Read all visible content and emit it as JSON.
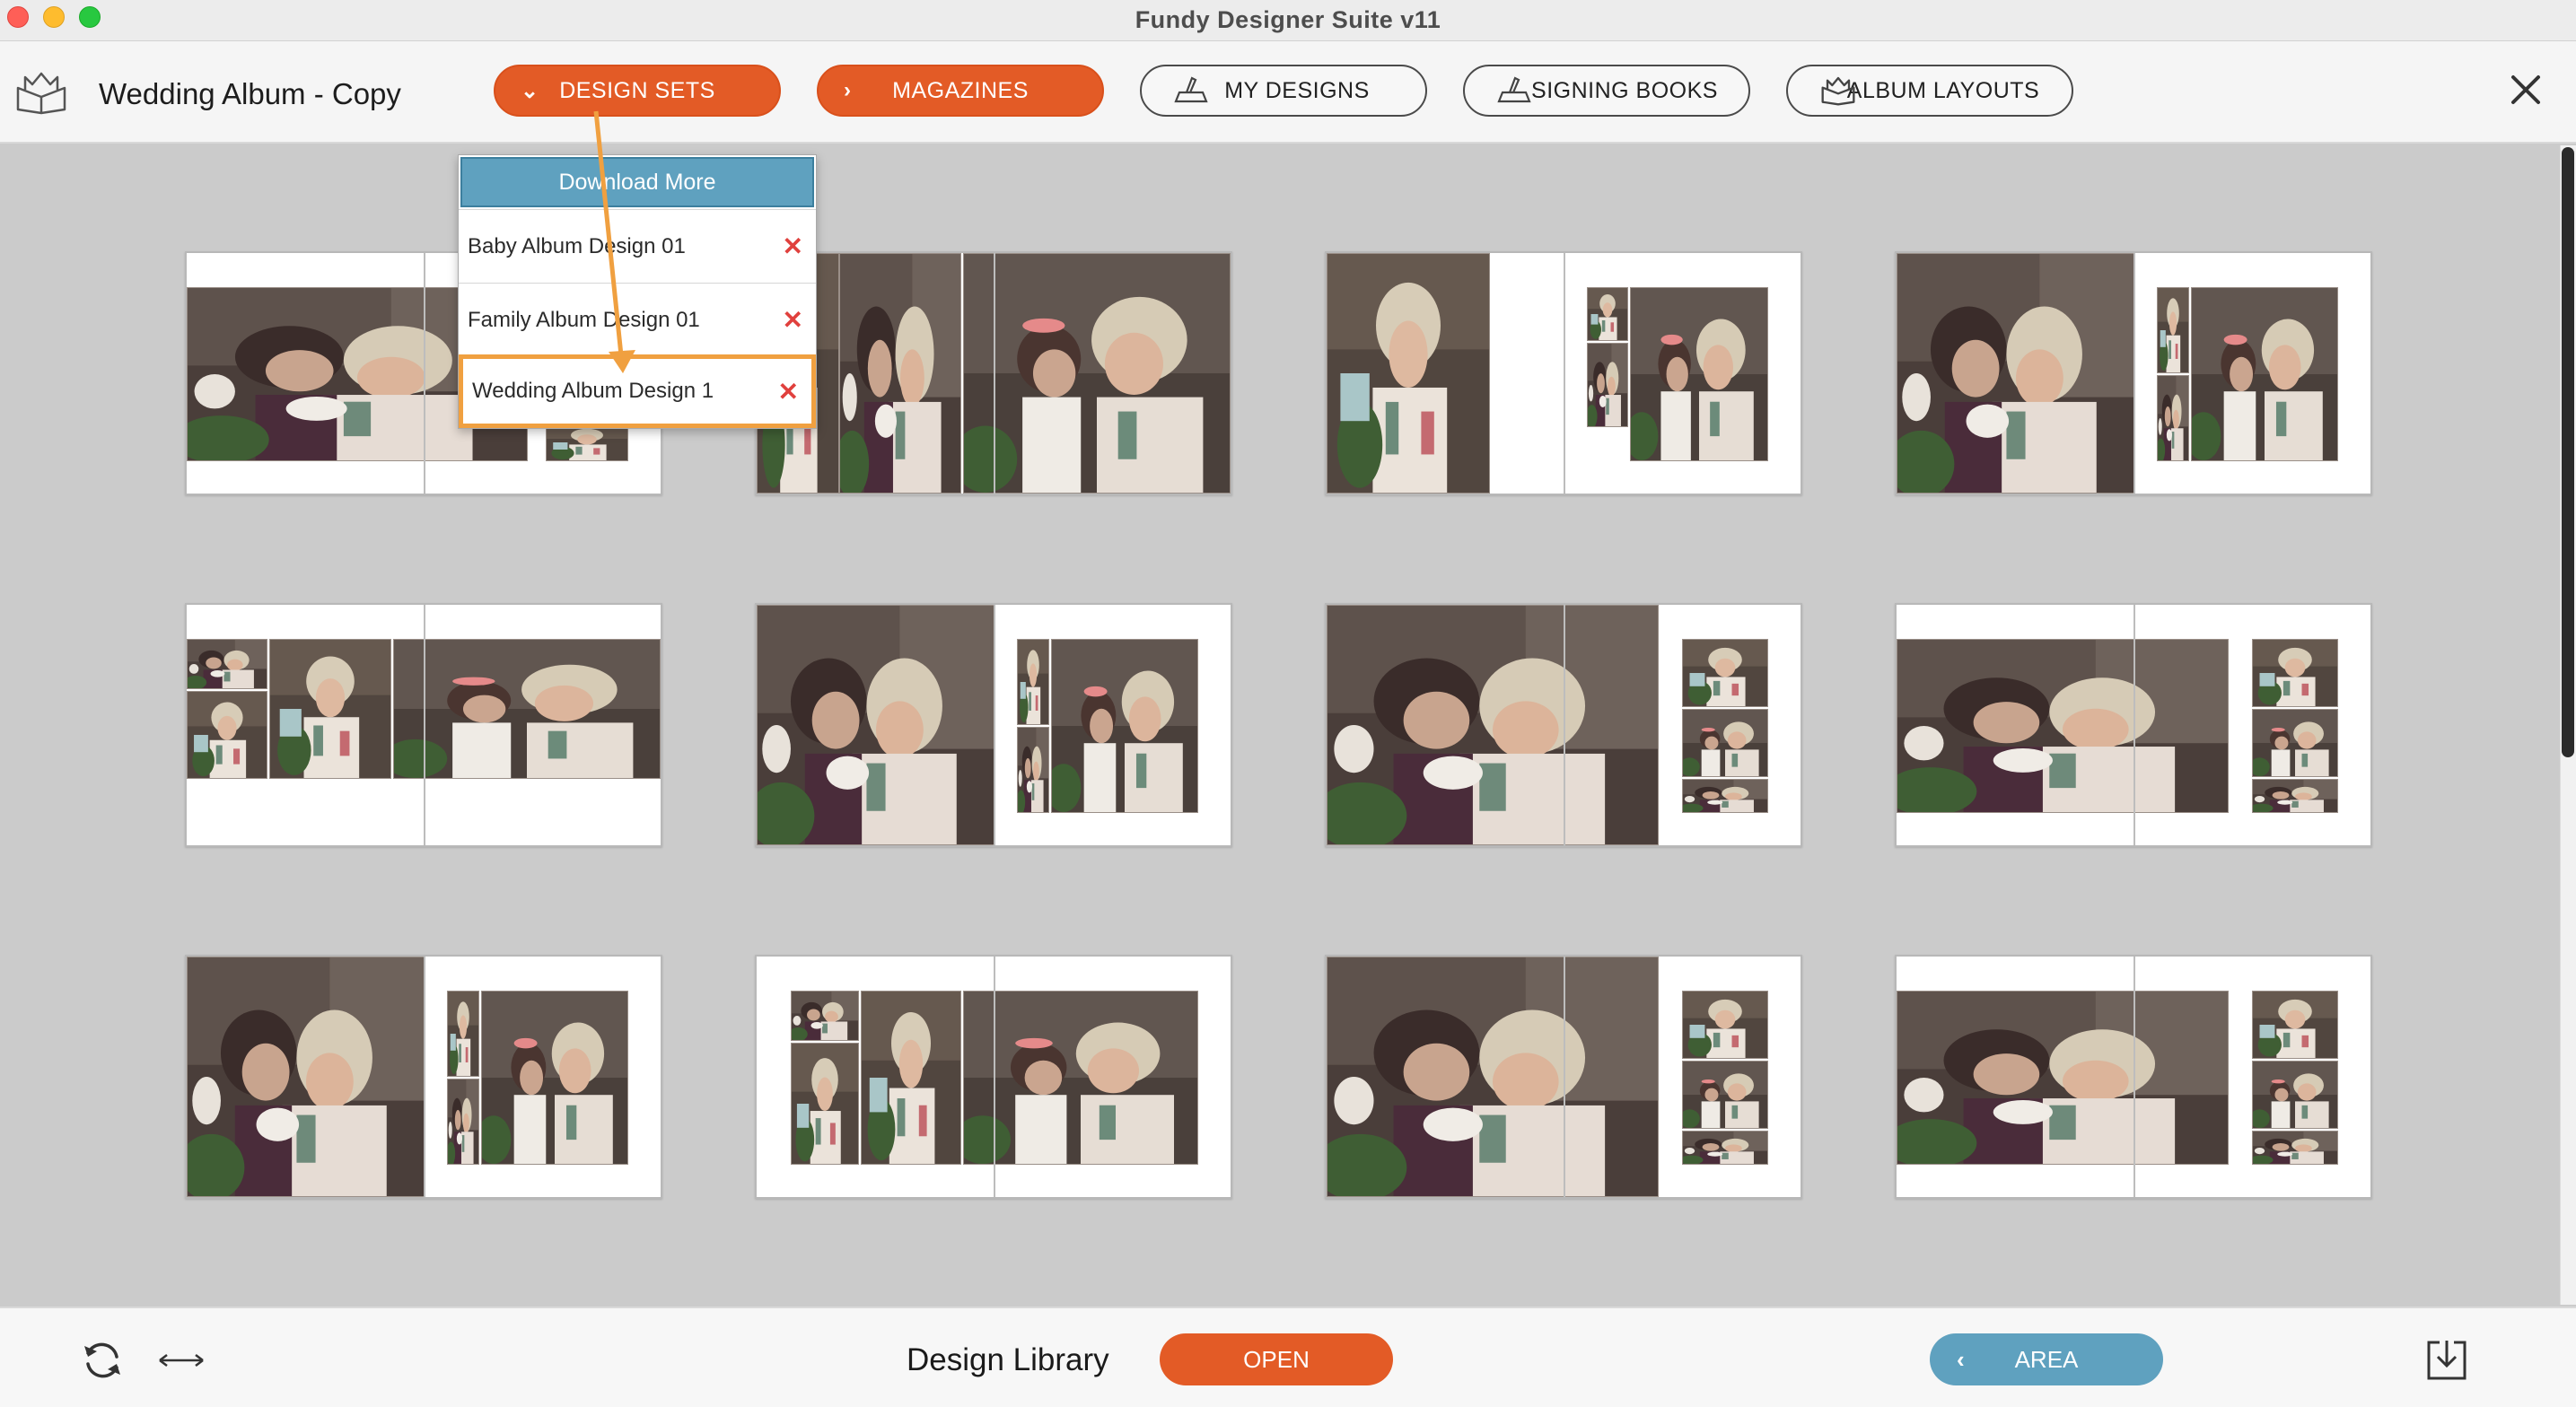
{
  "window": {
    "title": "Fundy Designer Suite v11"
  },
  "toolbar": {
    "album_name": "Wedding Album - Copy",
    "buttons": [
      {
        "label": "DESIGN SETS",
        "icon": "chevron-down-icon"
      },
      {
        "label": "MAGAZINES",
        "icon": "chevron-right-icon"
      },
      {
        "label": "MY DESIGNS",
        "icon": "hand-book-icon"
      },
      {
        "label": "SIGNING BOOKS",
        "icon": "hand-book-icon"
      },
      {
        "label": "ALBUM LAYOUTS",
        "icon": "album-icon"
      }
    ]
  },
  "dropdown": {
    "download_label": "Download More",
    "items": [
      {
        "label": "Baby Album Design 01"
      },
      {
        "label": "Family Album Design 01"
      },
      {
        "label": "Wedding Album Design 1",
        "selected": true
      }
    ]
  },
  "footer": {
    "title": "Design Library",
    "open_label": "OPEN",
    "area_label": "AREA"
  },
  "colors": {
    "orange": "#e35b26",
    "blue": "#5fa1bf",
    "highlight": "#f0a040",
    "remove_x": "#e0403d"
  }
}
